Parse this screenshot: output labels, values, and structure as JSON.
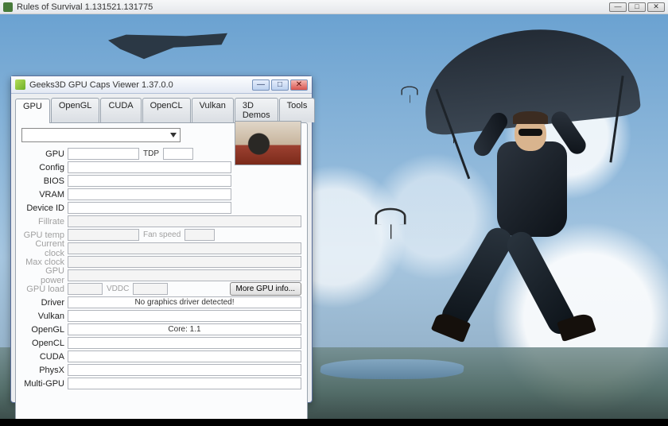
{
  "outer_window": {
    "title": "Rules of Survival 1.131521.131775"
  },
  "gpu_window": {
    "title": "Geeks3D GPU Caps Viewer 1.37.0.0",
    "tabs": [
      "GPU",
      "OpenGL",
      "CUDA",
      "OpenCL",
      "Vulkan",
      "3D Demos",
      "Tools"
    ],
    "active_tab": "GPU",
    "dropdown_value": "",
    "labels": {
      "gpu": "GPU",
      "tdp": "TDP",
      "config": "Config",
      "bios": "BIOS",
      "vram": "VRAM",
      "device_id": "Device ID",
      "fillrate": "Fillrate",
      "gpu_temp": "GPU temp",
      "fan_speed": "Fan speed",
      "current_clock": "Current clock",
      "max_clock": "Max clock",
      "gpu_power": "GPU power",
      "gpu_load": "GPU load",
      "vddc": "VDDC",
      "more_info": "More GPU info...",
      "driver": "Driver",
      "vulkan": "Vulkan",
      "opengl": "OpenGL",
      "opencl": "OpenCL",
      "cuda": "CUDA",
      "physx": "PhysX",
      "multi_gpu": "Multi-GPU"
    },
    "values": {
      "gpu": "",
      "tdp": "",
      "config": "",
      "bios": "",
      "vram": "",
      "device_id": "",
      "fillrate": "",
      "gpu_temp": "",
      "fan_speed": "",
      "current_clock": "",
      "max_clock": "",
      "gpu_power": "",
      "gpu_load": "",
      "vddc": "",
      "driver": "No graphics driver detected!",
      "vulkan": "",
      "opengl": "Core: 1.1",
      "opencl": "",
      "cuda": "",
      "physx": "",
      "multi_gpu": ""
    }
  }
}
